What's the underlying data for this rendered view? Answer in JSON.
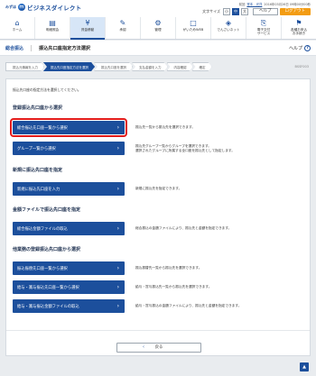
{
  "header": {
    "logo_prefix": "みずほ",
    "logo_text": "ビジネスダイレクト",
    "user_prefix": "前回",
    "user_name": "堂本　光洋",
    "user_suffix": "2016年03月26日 09時00分00秒",
    "font_size_label": "文字サイズ",
    "font_sizes": [
      "小",
      "中",
      "大"
    ],
    "help_label": "ヘルプ",
    "logout_label": "ログアウト"
  },
  "gnav": [
    {
      "icon": "⌂",
      "label": "ホーム"
    },
    {
      "icon": "▤",
      "label": "明細照会"
    },
    {
      "icon": "¥",
      "label": "資金移動"
    },
    {
      "icon": "✎",
      "label": "承認"
    },
    {
      "icon": "⚙",
      "label": "管理"
    },
    {
      "icon": "□",
      "label": "がいためWEB"
    },
    {
      "icon": "◈",
      "label": "でんさいネット"
    },
    {
      "icon": "⎘",
      "label": "電子交付\nサービス"
    },
    {
      "icon": "⚑",
      "label": "各種お申込\nお手続き"
    }
  ],
  "subheader": {
    "category": "総合振込",
    "title": "振込先口座指定方法選択",
    "screen_id": "BSSF003",
    "help": "ヘルプ"
  },
  "steps": [
    "振込元情報を入力",
    "振込先口座指定方法を選択",
    "振込先口座を選択",
    "支払金額を入力",
    "内容確認",
    "確定"
  ],
  "intro": "振込先口座の指定方法を選択してください。",
  "sections": {
    "registered": {
      "title": "登録振込先口座から選択",
      "items": [
        {
          "label": "総合振込先口座一覧から選択",
          "desc": "振込先一覧から振込先を選択できます。"
        },
        {
          "label": "グループ一覧から選択",
          "desc": "振込先グループ一覧からグループを選択できます。\n選択されたグループに所属する全口座を振込先として指定します。"
        }
      ]
    },
    "new": {
      "title": "新規に振込先口座を指定",
      "items": [
        {
          "label": "新規に振込先口座を入力",
          "desc": "新規に振込先を指定できます。"
        }
      ]
    },
    "file": {
      "title": "金額ファイルで振込先口座を指定",
      "items": [
        {
          "label": "総合振込金額ファイルの取込",
          "desc": "総合振込の金額ファイルにより、振込先と金額を指定できます。"
        }
      ]
    },
    "other": {
      "title": "他業務の登録振込先口座から選択",
      "items": [
        {
          "label": "振込振替先口座一覧から選択",
          "desc": "振込振替先一覧から振込先を選択できます。"
        },
        {
          "label": "給与・賞与振込先口座一覧から選択",
          "desc": "給与・賞与振込先一覧から振込先を選択できます。"
        },
        {
          "label": "給与・賞与振込金額ファイルの取込",
          "desc": "給与・賞与振込の金額ファイルにより、振込先と金額を指定できます。"
        }
      ]
    }
  },
  "back_label": "戻る",
  "page_top": "▲"
}
